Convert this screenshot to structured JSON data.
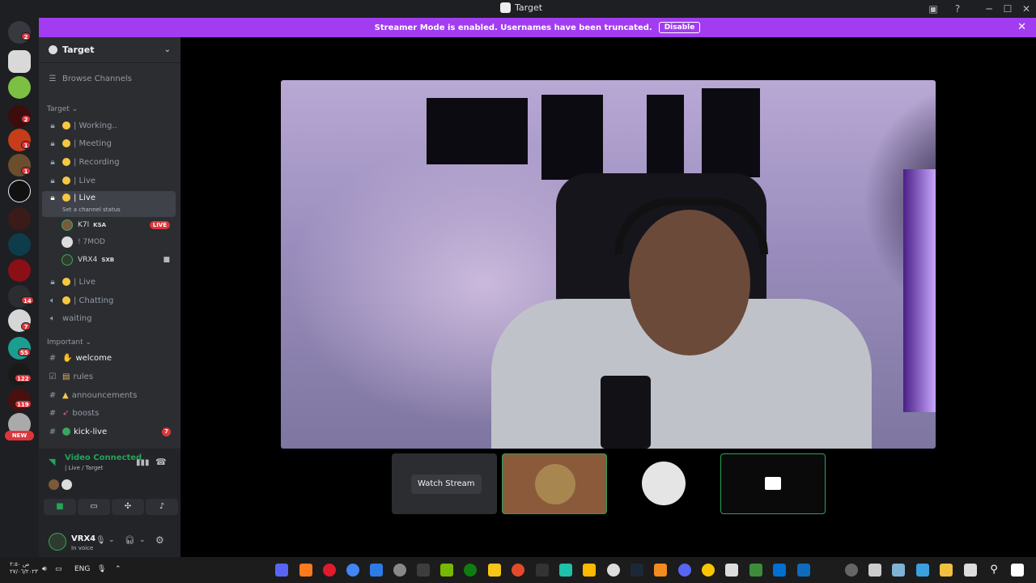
{
  "window": {
    "title": "Target"
  },
  "banner": {
    "text": "Streamer Mode is enabled. Usernames have been truncated.",
    "button": "Disable"
  },
  "rail": {
    "badges": [
      {
        "label": "2"
      },
      {
        "label": "2"
      },
      {
        "label": "1"
      },
      {
        "label": "1"
      },
      {
        "label": "14"
      },
      {
        "label": "7"
      },
      {
        "label": "55"
      },
      {
        "label": "122"
      },
      {
        "label": "119"
      }
    ],
    "new_label": "NEW"
  },
  "sidebar": {
    "guild_name": "Target",
    "browse": "Browse Channels",
    "cat_target": "Target",
    "voice_channels": [
      {
        "name": "| Working.."
      },
      {
        "name": "| Meeting"
      },
      {
        "name": "| Recording"
      },
      {
        "name": "| Live"
      },
      {
        "name": "| Live"
      }
    ],
    "channel_status_hint": "Set a channel status",
    "voice_users": [
      {
        "name": "K7l",
        "tag": "KSA",
        "live": "LIVE"
      },
      {
        "name": "! 7MOD"
      },
      {
        "name": "VRX4",
        "tag": "SXB"
      }
    ],
    "voice_channels_2": [
      {
        "name": "| Live"
      },
      {
        "name": "| Chatting"
      },
      {
        "name": "waiting"
      }
    ],
    "cat_important": "Important",
    "text_channels": [
      {
        "name": "welcome"
      },
      {
        "name": "rules"
      },
      {
        "name": "announcements"
      },
      {
        "name": "boosts"
      },
      {
        "name": "kick-live",
        "mentions": "7"
      }
    ]
  },
  "voice_panel": {
    "status": "Video Connected",
    "sub": "| Live / Target"
  },
  "user_panel": {
    "name": "VRX4",
    "status": "In voice"
  },
  "stage": {
    "watch_stream": "Watch Stream"
  },
  "taskbar": {
    "date_line1": "ص ٢:٥٠",
    "date_line2": "٢٧/٠٦/٢٠٢٣",
    "lang": "ENG"
  },
  "colors": {
    "accent": "#a23cf0",
    "connected": "#23a55a",
    "badge": "#da373c"
  }
}
